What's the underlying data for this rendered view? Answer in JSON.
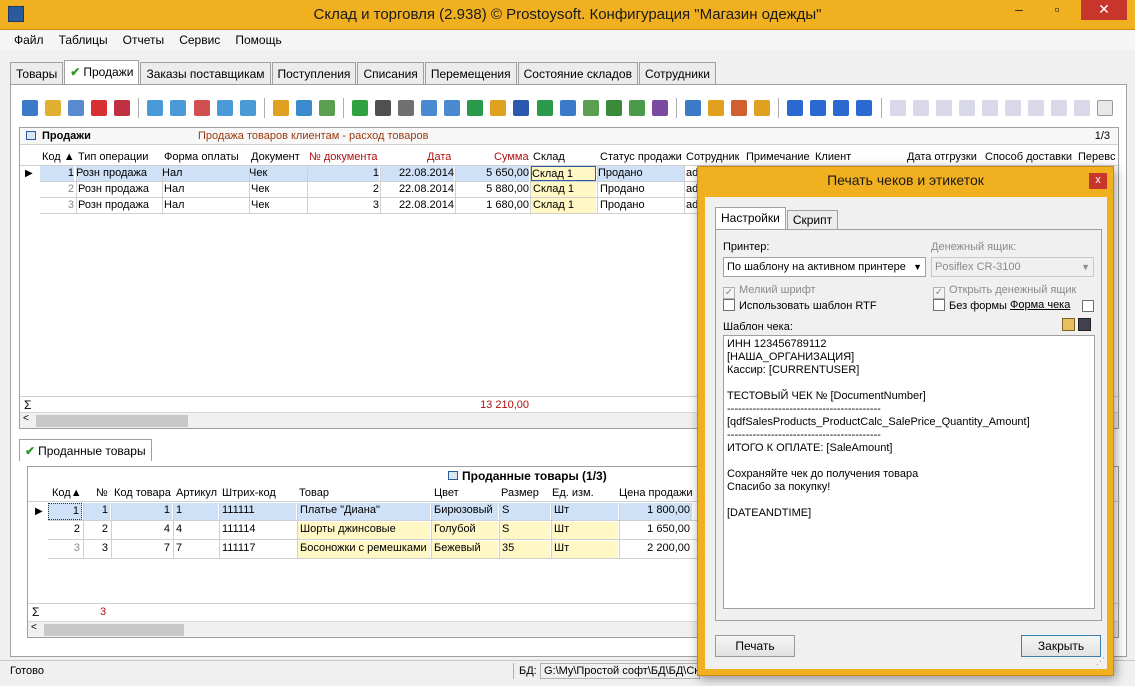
{
  "window": {
    "title": "Склад и торговля (2.938) © Prostoysoft. Конфигурация \"Магазин одежды\""
  },
  "menu": [
    "Файл",
    "Таблицы",
    "Отчеты",
    "Сервис",
    "Помощь"
  ],
  "tabs": [
    "Товары",
    "Продажи",
    "Заказы поставщикам",
    "Поступления",
    "Списания",
    "Перемещения",
    "Состояние складов",
    "Сотрудники"
  ],
  "toolbar_right_icons": [
    "НАК",
    "СЧЕТ",
    "ФАК",
    "Т-12",
    "АКТ",
    "ДОГ",
    "ТТН",
    "ЧЕК",
    "ЧЕК",
    "1С"
  ],
  "sales": {
    "title": "Продажи",
    "subtitle": "Продажа товаров клиентам - расход товаров",
    "counter": "1/3",
    "columns": [
      "Код",
      "Тип операции",
      "Форма оплаты",
      "Документ",
      "№ документа",
      "Дата",
      "Сумма",
      "Склад",
      "Статус продажи",
      "Сотрудник",
      "Примечание",
      "Клиент",
      "Дата отгрузки",
      "Способ доставки",
      "Перевс"
    ],
    "rows": [
      [
        "1",
        "Розн продажа",
        "Нал",
        "Чек",
        "1",
        "22.08.2014",
        "5 650,00",
        "Склад 1",
        "Продано",
        "adi"
      ],
      [
        "2",
        "Розн продажа",
        "Нал",
        "Чек",
        "2",
        "22.08.2014",
        "5 880,00",
        "Склад 1",
        "Продано",
        "adi"
      ],
      [
        "3",
        "Розн продажа",
        "Нал",
        "Чек",
        "3",
        "22.08.2014",
        "1 680,00",
        "Склад 1",
        "Продано",
        "adi"
      ]
    ],
    "sigma": "Σ",
    "total": "13 210,00"
  },
  "sold_items": {
    "tab": "Проданные товары",
    "title": "Проданные товары (1/3)",
    "columns": [
      "Код",
      "№",
      "Код товара",
      "Артикул",
      "Штрих-код",
      "Товар",
      "Цвет",
      "Размер",
      "Ед. изм.",
      "Цена продажи"
    ],
    "rows": [
      [
        "1",
        "1",
        "1",
        "1",
        "111111",
        "Платье \"Диана\"",
        "Бирюзовый",
        "S",
        "Шт",
        "1 800,00"
      ],
      [
        "2",
        "2",
        "4",
        "4",
        "111114",
        "Шорты джинсовые",
        "Голубой",
        "S",
        "Шт",
        "1 650,00"
      ],
      [
        "3",
        "3",
        "7",
        "7",
        "111117",
        "Босоножки с ремешками",
        "Бежевый",
        "35",
        "Шт",
        "2 200,00"
      ]
    ],
    "sigma": "Σ",
    "total": "3"
  },
  "status": {
    "text": "Готово",
    "db_label": "БД:",
    "db_path": "G:\\My\\Простой софт\\БД\\БД\\Ск"
  },
  "dialog": {
    "title": "Печать чеков и этикеток",
    "close": "x",
    "tabs": [
      "Настройки",
      "Скрипт"
    ],
    "printer_label": "Принтер:",
    "printer_value": "По шаблону на активном принтере",
    "cashbox_label": "Денежный ящик:",
    "cashbox_value": "Posiflex CR-3100",
    "small_font": "Мелкий шрифт",
    "use_rtf": "Использовать шаблон RTF",
    "open_cashbox": "Открыть денежный ящик",
    "no_form": "Без формы",
    "form_link": "Форма чека",
    "template_label": "Шаблон чека:",
    "template_text": "ИНН 123456789112\n[НАША_ОРГАНИЗАЦИЯ]\nКассир: [CURRENTUSER]\n\nТЕСТОВЫЙ ЧЕК № [DocumentNumber]\n------------------------------------------\n[qdfSalesProducts_ProductCalc_SalePrice_Quantity_Amount]\n------------------------------------------\nИТОГО К ОПЛАТЕ: [SaleAmount]\n\nСохраняйте чек до получения товара\nСпасибо за покупку!\n\n[DATEANDTIME]",
    "print_button": "Печать",
    "close_button": "Закрыть"
  }
}
